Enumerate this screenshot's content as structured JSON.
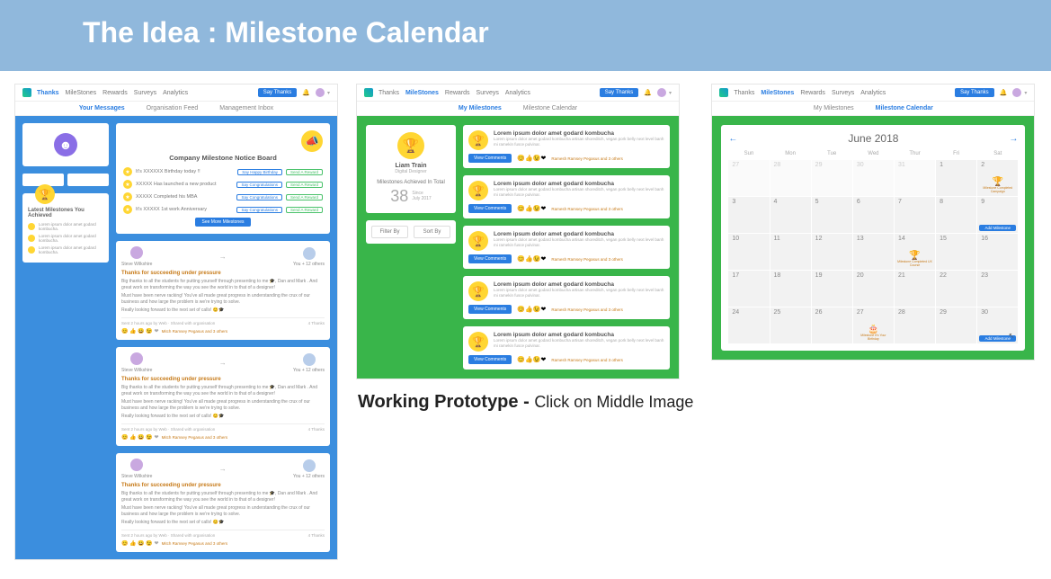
{
  "banner": {
    "title": "The Idea : Milestone Calendar"
  },
  "nav": {
    "items": [
      "Thanks",
      "MileStones",
      "Rewards",
      "Surveys",
      "Analytics"
    ],
    "cta": "Say Thanks"
  },
  "subtabsA": [
    "Your Messages",
    "Organisation Feed",
    "Management Inbox"
  ],
  "subtabsB": [
    "My Milestones",
    "Milestone Calendar"
  ],
  "notice": {
    "title": "Company Milestone Notice Board",
    "rows": [
      {
        "label": "It's XXXXXX Birthday today !!",
        "pill1": "Say Happy Birthday",
        "pill2": "Send A Reward"
      },
      {
        "label": "XXXXX Has launched a new product",
        "pill1": "Say Congratulations",
        "pill2": "Send A Reward"
      },
      {
        "label": "XXXXX Completed his MBA",
        "pill1": "Say Congratulations",
        "pill2": "Send A Reward"
      },
      {
        "label": "It's XXXXX 1st work Anniversary",
        "pill1": "Say Congratulations",
        "pill2": "Send A Reward"
      }
    ],
    "more": "See More Milestones"
  },
  "latest": {
    "title": "Latest Milestones You Achieved",
    "rows": [
      "Lorem ipsum dolor amet godard kombucha.",
      "Lorem ipsum dolor amet godard kombucha.",
      "Lorem ipsum dolor amet godard kombucha."
    ]
  },
  "post": {
    "from": "Steve Wilkshire",
    "to": "You + 12 others",
    "title": "Thanks for succeeding under pressure",
    "p1": "Big thanks to all the students for putting yourself through presenting to me 🎓, Dan and Mark . And great work on transforming the way you see the world in to that of a designer!",
    "p2": "Must have been nerve racking! You've all made great progress in understanding the crux of our business and how large the problem is we're trying to solve.",
    "p3": "Really looking forward to the next set of calls! 😊🎓",
    "meta_left": "Sent 2 hours ago by Web · Shared with organisation",
    "meta_right": "4 Thanks",
    "emoji_text": "Mitch Ramsey Pegasus and 3 others"
  },
  "profile": {
    "name": "Liam Train",
    "role": "Digital Designer",
    "ach": "Milestones Achieved In Total",
    "count": "38",
    "since_label": "Since",
    "since_date": "July 2017"
  },
  "filter": {
    "a": "Filter By",
    "b": "Sort By"
  },
  "ms": {
    "title": "Lorem ipsum dolor amet godard kombucha",
    "body": "Lorem ipsum dolor amet godard kombucha artisan shoreditch, vegan pork belly next level banh mi ramekin fusce pulvinar.",
    "vc": "View Comments",
    "ftxt": "Ramesh Ramsey Pegasus and 3 others"
  },
  "cal": {
    "month": "June 2018",
    "dow": [
      "Sun",
      "Mon",
      "Tue",
      "Wed",
      "Thur",
      "Fri",
      "Sat"
    ],
    "events": {
      "2": "Milestone\nCompleted Campaign",
      "14": "Milestone\nCompleted UX Course",
      "27": "Milestone\nIt's Your Birthday"
    },
    "add": "Add Milestone"
  },
  "proto": {
    "bold": "Working Prototype - ",
    "rest": "Click on Middle Image"
  }
}
